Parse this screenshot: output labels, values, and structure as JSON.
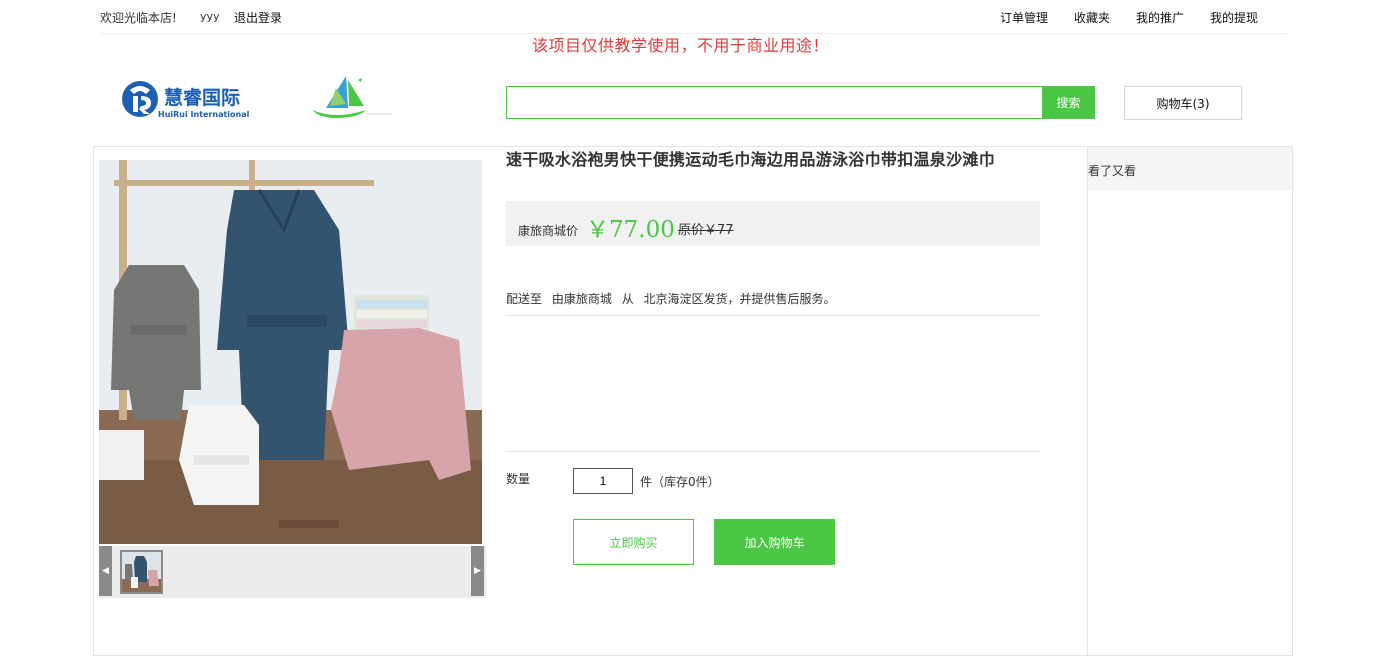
{
  "topbar": {
    "welcome": "欢迎光临本店!",
    "username": "yyy",
    "logout": "退出登录",
    "links": [
      "订单管理",
      "收藏夹",
      "我的推广",
      "我的提现"
    ]
  },
  "notice": "该项目仅供教学使用，不用于商业用途！",
  "logo": {
    "name": "慧睿国际",
    "sub": "HuiRui International"
  },
  "search": {
    "value": "",
    "placeholder": "",
    "button": "搜索"
  },
  "cart": {
    "label": "购物车(3)"
  },
  "product": {
    "title": "速干吸水浴袍男快干便携运动毛巾海边用品游泳浴巾带扣温泉沙滩巾",
    "price_label": "康旅商城价",
    "price": "￥77.00",
    "original_price": "原价￥77",
    "delivery": {
      "label": "配送至",
      "by": "由康旅商城",
      "from": "从",
      "desc": "北京海淀区发货，并提供售后服务。"
    },
    "qty_label": "数量",
    "qty_value": "1",
    "qty_unit": "件（库存0件）",
    "buy_now": "立即购买",
    "add_cart": "加入购物车"
  },
  "sidebar": {
    "title": "看了又看"
  },
  "colors": {
    "accent": "#4cc645",
    "notice": "#e23b3b",
    "price_bg": "#f1f1f1"
  }
}
